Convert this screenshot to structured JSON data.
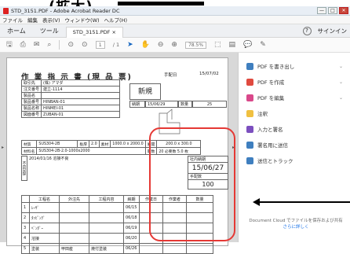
{
  "overlay": {
    "top_text": "(拡大)"
  },
  "window": {
    "title": "STD_3151.PDF - Adobe Acrobat Reader DC",
    "min": "—",
    "max": "□",
    "close": "✕"
  },
  "menu": [
    "ファイル",
    "編集",
    "表示(V)",
    "ウィンドウ(W)",
    "ヘルプ(H)"
  ],
  "tabs": {
    "home": "ホーム",
    "tools": "ツール",
    "doc": "STD_3151.PDF",
    "doc_close": "×",
    "help": "?",
    "signin": "サインイン"
  },
  "toolbar": {
    "page": "1",
    "page_total": "/ 1",
    "zoom": "78.5%"
  },
  "panel": {
    "items": [
      {
        "label": "PDF を書き出し",
        "color": "#3f7fbf"
      },
      {
        "label": "PDF を作成",
        "color": "#e04a3f"
      },
      {
        "label": "PDF を編集",
        "color": "#d9488a"
      },
      {
        "label": "注釈",
        "color": "#f0c040"
      },
      {
        "label": "入力と署名",
        "color": "#7c4fbf"
      },
      {
        "label": "署名用に送信",
        "color": "#3f7fbf"
      },
      {
        "label": "送信とトラック",
        "color": "#3f7fbf"
      }
    ],
    "bottom_text": "Document Cloud でファイルを保存および共有",
    "bottom_link": "さらに詳しく"
  },
  "form": {
    "title": "作 業 指 示 書 (現 品 票)",
    "no_label": "手配日",
    "date": "15/07/02",
    "customer_label": "取引先",
    "customer": "(株) アマダ",
    "order_label": "注文番号",
    "order": "建立-1114",
    "new_label": "新規",
    "deadline_label": "納期",
    "deadline": "15/06/29",
    "qty_label": "数量",
    "qty": "25",
    "product_label": "製品名",
    "part_no_label": "製品番号",
    "part_no": "HINBAN-01",
    "part2_label": "製品名称",
    "part2": "HINMEI-01",
    "drawing_label": "図面番号",
    "drawing": "ZUBAN-01",
    "material_label": "材質",
    "material": "SUS304-2B",
    "thick_label": "板厚",
    "thick": "2.0",
    "size_label": "素材",
    "size": "1000.0 x 2000.0",
    "prod_label": "展開",
    "prod": "200.0 x 300.0",
    "matno_label": "材料名",
    "matno": "SUS304-2B-2.0-1000x2000",
    "count_label": "取数",
    "count": "20",
    "req_label": "必要数",
    "req": "5.0 枚",
    "note_side": "不良記録",
    "note": "2014/01/16 溶接不良",
    "in_label": "社内納期",
    "in_date": "15/06/27",
    "mfg_label": "手配数",
    "mfg": "100",
    "proc_headers": [
      "工程名",
      "外注先",
      "工程内容",
      "納期",
      "作業日",
      "作業者",
      "数量"
    ],
    "proc_rows": [
      {
        "no": "1",
        "name": "ﾚｰｻﾞ",
        "vendor": "",
        "content": "",
        "date": "06/15"
      },
      {
        "no": "2",
        "name": "ﾀｯﾋﾟﾝｸﾞ",
        "vendor": "",
        "content": "",
        "date": "06/18"
      },
      {
        "no": "3",
        "name": "ﾍﾞﾝﾀﾞｰ",
        "vendor": "",
        "content": "",
        "date": "06/19"
      },
      {
        "no": "4",
        "name": "溶接",
        "vendor": "",
        "content": "",
        "date": "06/20"
      },
      {
        "no": "5",
        "name": "塗装",
        "vendor": "甲田産",
        "content": "焼付塗装",
        "date": "06/26"
      }
    ]
  }
}
